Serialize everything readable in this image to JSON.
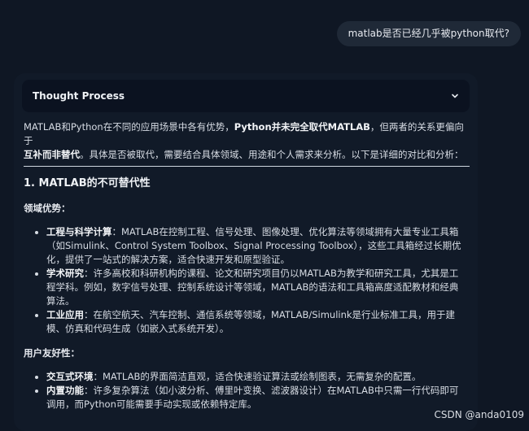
{
  "user_message": "matlab是否已经几乎被python取代?",
  "thought_panel": {
    "label": "Thought Process",
    "toggle_icon": "chevron-down-icon"
  },
  "answer": {
    "intro": {
      "part1": "MATLAB和Python在不同的应用场景中各有优势，",
      "bold1": "Python并未完全取代MATLAB",
      "part2": "，但两者的关系更偏向于",
      "bold2": "互补而非替代",
      "part3": "。具体是否被取代，需要结合具体领域、用途和个人需求来分析。以下是详细的对比和分析："
    },
    "section1_title": "1. MATLAB的不可替代性",
    "subsection1_title": "领域优势：",
    "domain_items": [
      {
        "term": "工程与科学计算",
        "text": "：MATLAB在控制工程、信号处理、图像处理、优化算法等领域拥有大量专业工具箱（如Simulink、Control System Toolbox、Signal Processing Toolbox），这些工具箱经过长期优化，提供了一站式的解决方案，适合快速开发和原型验证。"
      },
      {
        "term": "学术研究",
        "text": "：许多高校和科研机构的课程、论文和研究项目仍以MATLAB为教学和研究工具，尤其是工程学科。例如，数字信号处理、控制系统设计等领域，MATLAB的语法和工具箱高度适配教材和经典算法。"
      },
      {
        "term": "工业应用",
        "text": "：在航空航天、汽车控制、通信系统等领域，MATLAB/Simulink是行业标准工具，用于建模、仿真和代码生成（如嵌入式系统开发）。"
      }
    ],
    "subsection2_title": "用户友好性：",
    "usability_items": [
      {
        "term": "交互式环境",
        "text": "：MATLAB的界面简洁直观，适合快速验证算法或绘制图表，无需复杂的配置。"
      },
      {
        "term": "内置功能",
        "text": "：许多复杂算法（如小波分析、傅里叶变换、滤波器设计）在MATLAB中只需一行代码即可调用，而Python可能需要手动实现或依赖特定库。"
      }
    ]
  },
  "watermark": "CSDN @anda0109"
}
